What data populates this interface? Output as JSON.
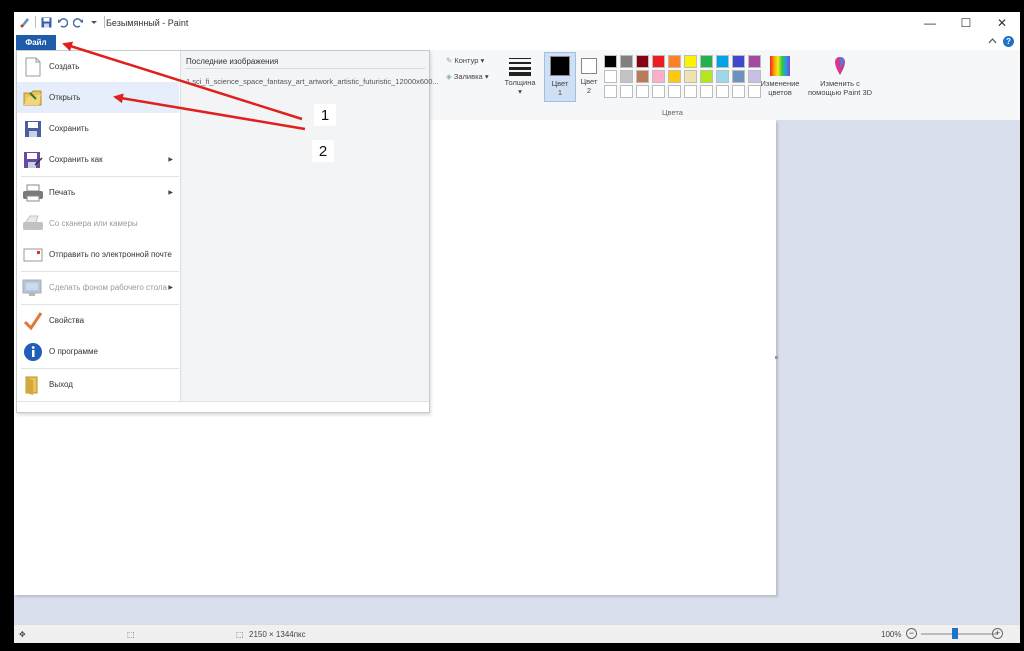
{
  "window": {
    "title": "Безымянный - Paint",
    "controls": [
      "—",
      "☐",
      "✕"
    ]
  },
  "ribbon": {
    "file_tab": "Файл",
    "tools": {
      "kontur": "Контур",
      "zalivka": "Заливка",
      "thickness": "Толщина",
      "color1": "Цвет 1",
      "color2": "Цвет 2",
      "edit_colors": "Изменение цветов",
      "paint3d": "Изменить с помощью Paint 3D"
    },
    "group_colors": "Цвета",
    "palette": [
      "#000000",
      "#7f7f7f",
      "#880015",
      "#ed1c24",
      "#ff7f27",
      "#fff200",
      "#22b14c",
      "#00a2e8",
      "#3f48cc",
      "#a349a4",
      "#ffffff",
      "#c3c3c3",
      "#b97a57",
      "#ffaec9",
      "#ffc90e",
      "#efe4b0",
      "#b5e61d",
      "#99d9ea",
      "#7092be",
      "#c8bfe7",
      "#ffffff",
      "#ffffff",
      "#ffffff",
      "#ffffff",
      "#ffffff",
      "#ffffff",
      "#ffffff",
      "#ffffff",
      "#ffffff",
      "#ffffff"
    ]
  },
  "file_menu": {
    "items": [
      {
        "label": "Создать",
        "icon": "new-file-icon",
        "disabled": false,
        "submenu": false
      },
      {
        "label": "Открыть",
        "icon": "open-folder-icon",
        "disabled": false,
        "submenu": false
      },
      {
        "label": "Сохранить",
        "icon": "save-icon",
        "disabled": false,
        "submenu": false
      },
      {
        "label": "Сохранить как",
        "icon": "save-as-icon",
        "disabled": false,
        "submenu": true
      },
      {
        "label": "Печать",
        "icon": "printer-icon",
        "disabled": false,
        "submenu": true
      },
      {
        "label": "Со сканера или камеры",
        "icon": "scanner-icon",
        "disabled": true,
        "submenu": false
      },
      {
        "label": "Отправить по электронной почте",
        "icon": "email-icon",
        "disabled": false,
        "submenu": false
      },
      {
        "label": "Сделать фоном рабочего стола",
        "icon": "desktop-background-icon",
        "disabled": true,
        "submenu": true
      },
      {
        "label": "Свойства",
        "icon": "checkmark-icon",
        "disabled": false,
        "submenu": false
      },
      {
        "label": "О программе",
        "icon": "info-icon",
        "disabled": false,
        "submenu": false
      },
      {
        "label": "Выход",
        "icon": "exit-icon",
        "disabled": false,
        "submenu": false
      }
    ],
    "recent_title": "Последние изображения",
    "recent_items": [
      "1   sci_fi_science_space_fantasy_art_artwork_artistic_futuristic_12000x600..."
    ]
  },
  "statusbar": {
    "dimensions": "2150 × 1344пкс",
    "zoom": "100%",
    "zoom_level": 1.0
  },
  "annotations": {
    "labels": [
      "1",
      "2"
    ],
    "arrow_color": "#e0201c"
  },
  "colors": {
    "accent": "#1e5ba8",
    "menu_selected": "#e5eefa",
    "canvas_bg": "#d9dfec"
  }
}
